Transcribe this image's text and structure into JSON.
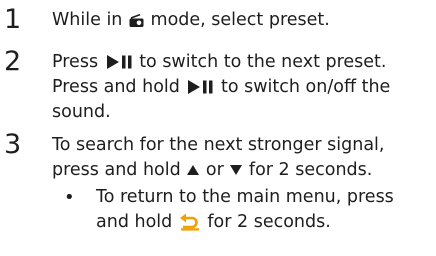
{
  "steps": [
    {
      "number": "1",
      "lines": [
        [
          "While in ",
          "radio-icon",
          " mode, select preset."
        ]
      ]
    },
    {
      "number": "2",
      "lines": [
        [
          "Press ",
          "play-pause-icon",
          " to switch to the next preset."
        ],
        [
          "Press and hold ",
          "play-pause-icon",
          " to switch on/off the"
        ],
        [
          "sound."
        ]
      ]
    },
    {
      "number": "3",
      "lines": [
        [
          "To search for the next stronger signal,"
        ],
        [
          "press and hold ",
          "up-arrow-icon",
          " or ",
          "down-arrow-icon",
          " for 2 seconds."
        ]
      ],
      "sub": {
        "bullet": "•",
        "lines": [
          [
            "To return to the main menu, press"
          ],
          [
            "and hold ",
            "back-icon",
            " for 2 seconds."
          ]
        ]
      }
    }
  ],
  "colors": {
    "text": "#1e1e1e",
    "icon": "#1e1e1e",
    "back_icon": "#f2a100"
  }
}
